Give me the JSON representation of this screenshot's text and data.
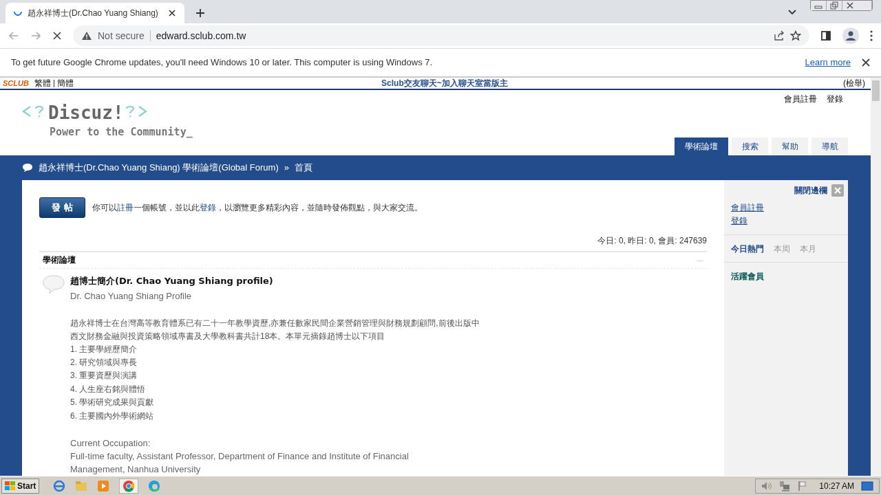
{
  "browser": {
    "tab_title": "趙永祥博士(Dr.Chao Yuang Shiang)",
    "security": "Not secure",
    "url": "edward.sclub.com.tw",
    "infobar": {
      "message": "To get future Google Chrome updates, you'll need Windows 10 or later. This computer is using Windows 7.",
      "link": "Learn more"
    }
  },
  "topbar": {
    "brand": "SCLUB",
    "langs": [
      "繁體",
      "簡體"
    ],
    "promo": "Sclub交友聊天~加入聊天室當版主",
    "right": "(檢舉)"
  },
  "header": {
    "logo_main": "Discuz!",
    "logo_sub": "Power to the Community_",
    "user_links": [
      "會員註冊",
      "登錄"
    ],
    "nav": [
      {
        "label": "學術論壇",
        "selected": true
      },
      {
        "label": "搜索",
        "selected": false
      },
      {
        "label": "幫助",
        "selected": false
      },
      {
        "label": "導航",
        "selected": false
      }
    ]
  },
  "breadcrumb": {
    "forum": "趙永祥博士(Dr.Chao Yuang Shiang) 學術論壇(Global Forum)",
    "sep": "»",
    "current": "首頁"
  },
  "main": {
    "post_button": "發 帖",
    "notice": [
      {
        "text": "你可以",
        "link": false
      },
      {
        "text": "註冊",
        "link": true
      },
      {
        "text": "一個帳號，並以此",
        "link": false
      },
      {
        "text": "登錄",
        "link": true
      },
      {
        "text": "，以瀏覽更多精彩內容，並隨時發佈觀點，與大家交流。",
        "link": false
      }
    ],
    "stats": "今日: 0, 昨日: 0, 會員: 247639",
    "section": "學術論壇",
    "collapse": "—",
    "forum": {
      "title": "趙博士簡介(Dr. Chao Yuang Shiang profile)",
      "subtitle": "Dr. Chao Yuang Shiang Profile",
      "intro": "趙永祥博士在台灣高等教育體系已有二十一年教學資歷,亦兼任數家民間企業營銷管理與財務規劃顧問,前後出版中西文財務金融與投資策略領域專書及大學教科書共計18本。本單元摘錄趙博士以下項目",
      "items": [
        "1. 主要學經歷簡介",
        "2. 研究領域與專長",
        "3. 重要資歷與演講",
        "4. 人生座右銘與體悟",
        "5. 學術研究成果與貢獻",
        "6. 主要國內外學術網站"
      ],
      "occupation_label": "Current Occupation:",
      "occupation": "Full-time faculty, Assistant Professor, Department of Finance and Institute of Financial Management, Nanhua University"
    }
  },
  "sidebar": {
    "close": "關閉邊欄",
    "links": [
      "會員註冊",
      "登錄"
    ],
    "tabs": [
      {
        "label": "今日熱門",
        "selected": true
      },
      {
        "label": "本周",
        "selected": false
      },
      {
        "label": "本月",
        "selected": false
      }
    ],
    "active_members": "活躍會員"
  },
  "taskbar": {
    "start": "Start",
    "clock": "10:27 AM"
  }
}
